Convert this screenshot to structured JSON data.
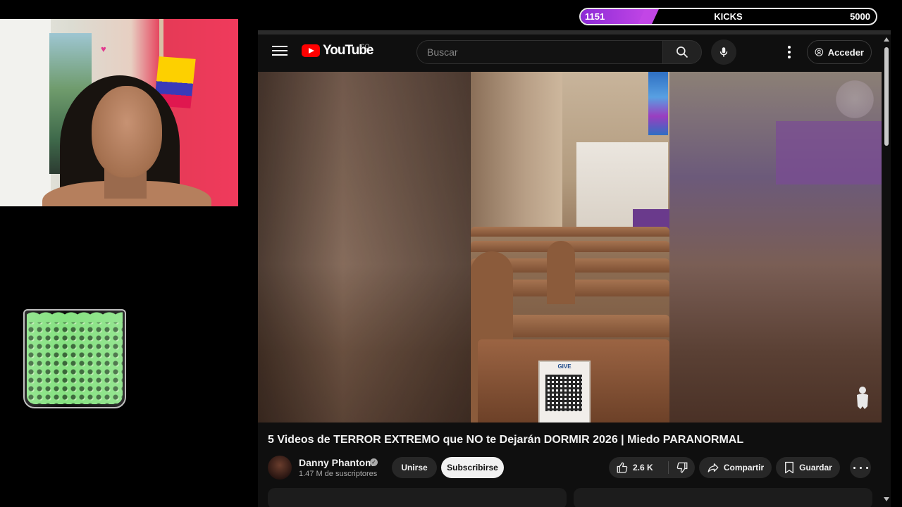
{
  "kicks": {
    "current": "1151",
    "label": "KICKS",
    "goal": "5000",
    "progress_fraction": 0.23
  },
  "webcam": {
    "description": ""
  },
  "youtube": {
    "logo_text": "YouTube",
    "country_code": "CO",
    "search": {
      "placeholder": "Buscar",
      "value": ""
    },
    "signin_label": "Acceder",
    "video": {
      "title": "5 Videos de TERROR EXTREMO que NO te Dejarán DORMIR 2026 | Miedo PARANORMAL",
      "qr_card_label": "GIVE"
    },
    "channel": {
      "name": "Danny Phantom",
      "subscribers": "1.47 M de suscriptores"
    },
    "actions": {
      "join": "Unirse",
      "subscribe": "Subscribirse",
      "likes": "2.6 K",
      "share": "Compartir",
      "save": "Guardar"
    }
  },
  "colors": {
    "accent": "#c246e6",
    "youtube_red": "#ff0000",
    "bg": "#0f0f0f"
  },
  "icons": [
    "menu-icon",
    "youtube-logo-icon",
    "search-icon",
    "mic-icon",
    "more-vert-icon",
    "account-icon",
    "ghost-icon",
    "verified-icon",
    "like-icon",
    "dislike-icon",
    "share-icon",
    "save-icon",
    "more-horiz-icon"
  ]
}
